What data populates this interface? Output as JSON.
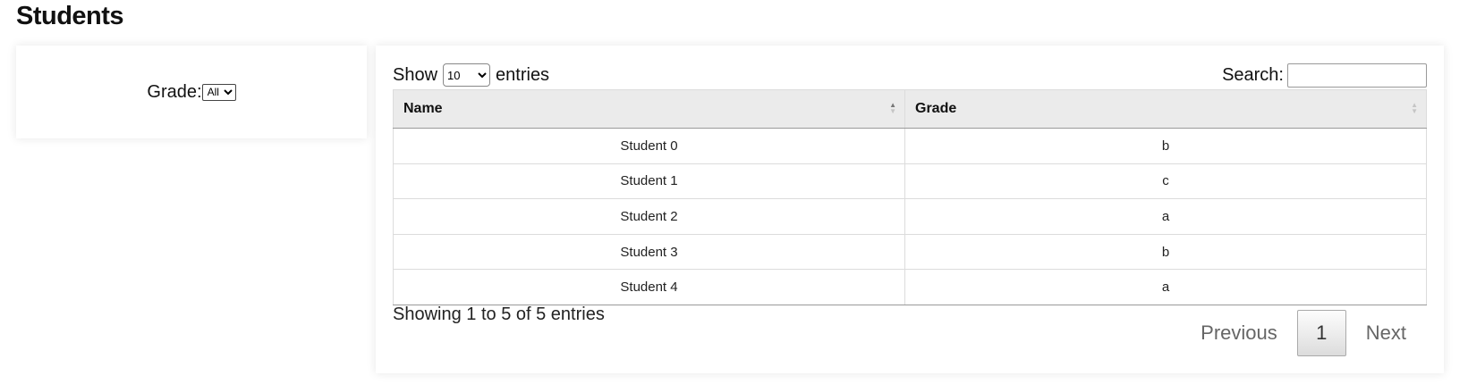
{
  "page": {
    "title": "Students"
  },
  "filter": {
    "label": "Grade:",
    "selected": "All",
    "options": [
      "All"
    ]
  },
  "table": {
    "length": {
      "prefix": "Show",
      "selected": "10",
      "suffix": "entries",
      "options": [
        "10"
      ]
    },
    "search_label": "Search:",
    "columns": [
      "Name",
      "Grade"
    ],
    "rows": [
      [
        "Student 0",
        "b"
      ],
      [
        "Student 1",
        "c"
      ],
      [
        "Student 2",
        "a"
      ],
      [
        "Student 3",
        "b"
      ],
      [
        "Student 4",
        "a"
      ]
    ],
    "info": "Showing 1 to 5 of 5 entries",
    "pagination": {
      "previous": "Previous",
      "current": "1",
      "next": "Next"
    }
  }
}
